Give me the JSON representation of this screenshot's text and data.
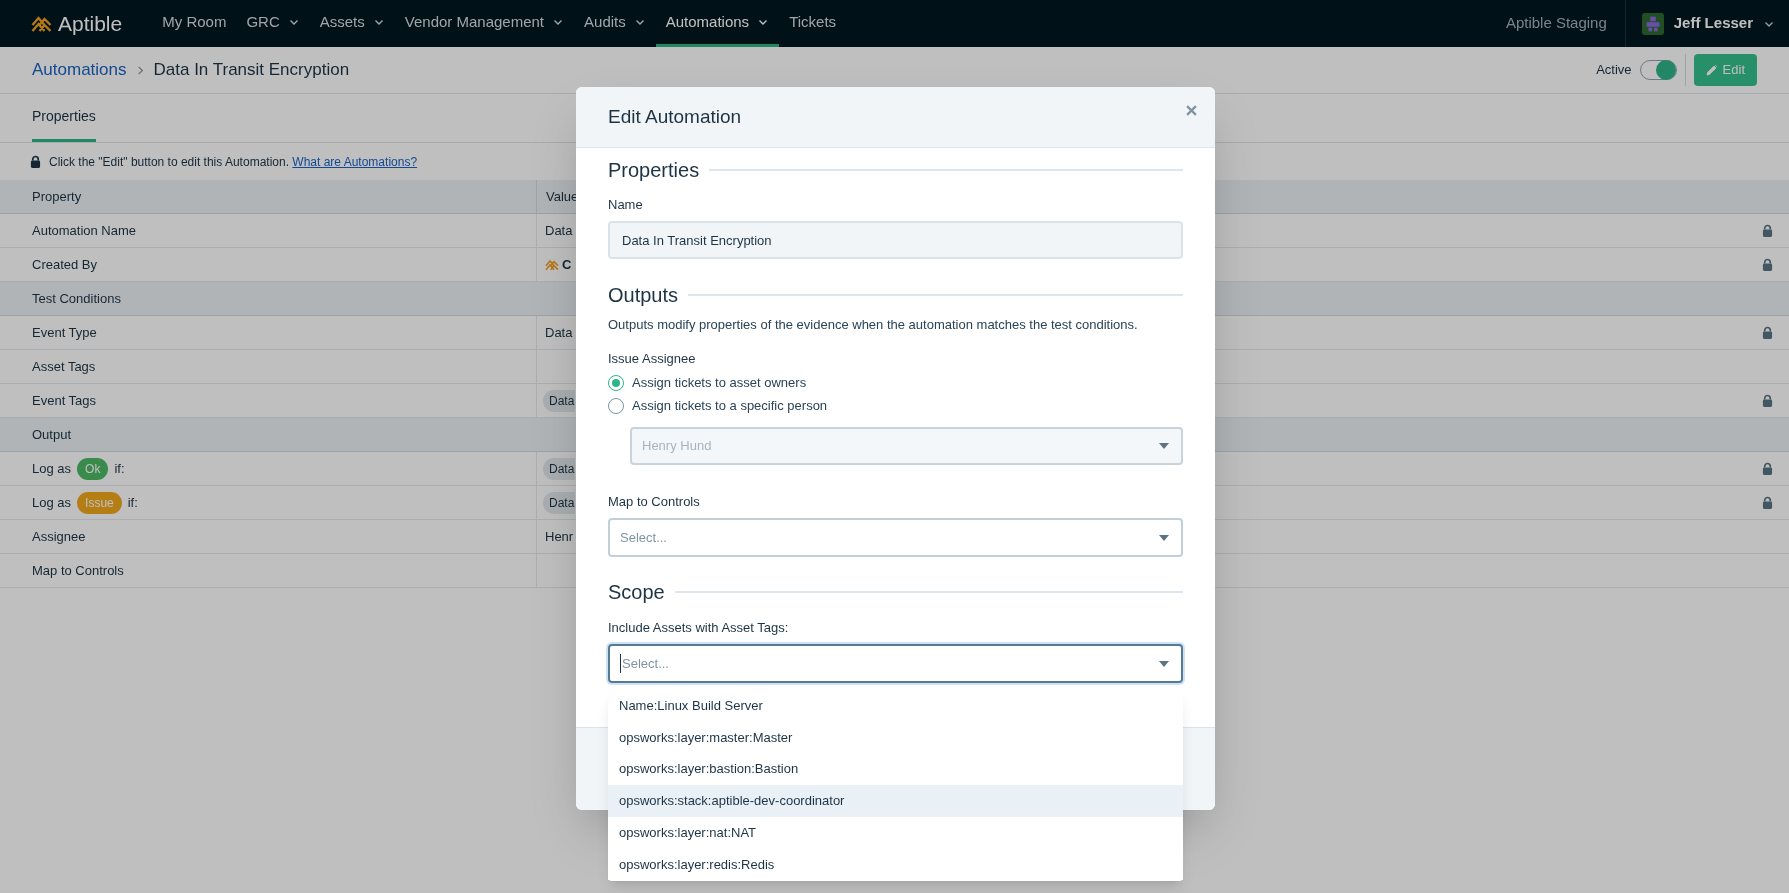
{
  "nav": {
    "logo": "Aptible",
    "items": [
      {
        "label": "My Room",
        "dropdown": false,
        "selected": false
      },
      {
        "label": "GRC",
        "dropdown": true,
        "selected": false
      },
      {
        "label": "Assets",
        "dropdown": true,
        "selected": false
      },
      {
        "label": "Vendor Management",
        "dropdown": true,
        "selected": false
      },
      {
        "label": "Audits",
        "dropdown": true,
        "selected": false
      },
      {
        "label": "Automations",
        "dropdown": true,
        "selected": true
      },
      {
        "label": "Tickets",
        "dropdown": false,
        "selected": false
      }
    ],
    "environment": "Aptible Staging",
    "user": "Jeff Lesser"
  },
  "breadcrumb": [
    "Automations",
    "Data In Transit Encryption"
  ],
  "page_header": {
    "active_label": "Active",
    "active": true,
    "edit_button": "Edit"
  },
  "tabs": [
    {
      "label": "Properties",
      "selected": true
    }
  ],
  "notice": {
    "text": "Click the \"Edit\" button to edit this Automation.",
    "link": "What are Automations?"
  },
  "table": {
    "columns": [
      "Property",
      "Value"
    ],
    "rows": [
      {
        "kind": "row",
        "property": "Automation Name",
        "value": {
          "kind": "text",
          "text": "Data"
        },
        "locked": true
      },
      {
        "kind": "row",
        "property": "Created By",
        "value": {
          "kind": "creator",
          "text": "C"
        },
        "locked": true
      },
      {
        "kind": "section",
        "property": "Test Conditions"
      },
      {
        "kind": "row",
        "property": "Event Type",
        "value": {
          "kind": "text",
          "text": "Data"
        },
        "locked": true
      },
      {
        "kind": "row",
        "property": "Asset Tags",
        "locked": false
      },
      {
        "kind": "row",
        "property": "Event Tags",
        "value": {
          "kind": "chip",
          "text": "Data"
        },
        "locked": true
      },
      {
        "kind": "section",
        "property": "Output"
      },
      {
        "kind": "log",
        "prefix": "Log as",
        "badge": {
          "kind": "ok",
          "text": "Ok"
        },
        "suffix": "if:",
        "value": {
          "kind": "chip",
          "text": "Data"
        },
        "locked": true
      },
      {
        "kind": "log",
        "prefix": "Log as",
        "badge": {
          "kind": "issue",
          "text": "Issue"
        },
        "suffix": "if:",
        "value": {
          "kind": "chip",
          "text": "Data"
        },
        "locked": true
      },
      {
        "kind": "row",
        "property": "Assignee",
        "value": {
          "kind": "text",
          "text": "Henr"
        },
        "locked": false
      },
      {
        "kind": "row",
        "property": "Map to Controls",
        "locked": false
      }
    ]
  },
  "modal": {
    "title": "Edit Automation",
    "properties_heading": "Properties",
    "name_label": "Name",
    "name_value": "Data In Transit Encryption",
    "outputs_heading": "Outputs",
    "outputs_description": "Outputs modify properties of the evidence when the automation matches the test conditions.",
    "assignee_label": "Issue Assignee",
    "assignee_options": [
      {
        "label": "Assign tickets to asset owners",
        "selected": true
      },
      {
        "label": "Assign tickets to a specific person",
        "selected": false
      }
    ],
    "person_select": {
      "value": "Henry Hund",
      "disabled": true
    },
    "map_label": "Map to Controls",
    "map_select": {
      "placeholder": "Select...",
      "focused": false
    },
    "scope_heading": "Scope",
    "tags_label": "Include Assets with Asset Tags:",
    "tags_select": {
      "placeholder": "Select...",
      "focused": true
    },
    "tag_options": [
      {
        "label": "Name:Linux Build Server",
        "selected": false
      },
      {
        "label": "opsworks:layer:master:Master",
        "selected": false
      },
      {
        "label": "opsworks:layer:bastion:Bastion",
        "selected": false
      },
      {
        "label": "opsworks:stack:aptible-dev-coordinator",
        "selected": true
      },
      {
        "label": "opsworks:layer:nat:NAT",
        "selected": false
      },
      {
        "label": "opsworks:layer:redis:Redis",
        "selected": false
      }
    ]
  }
}
